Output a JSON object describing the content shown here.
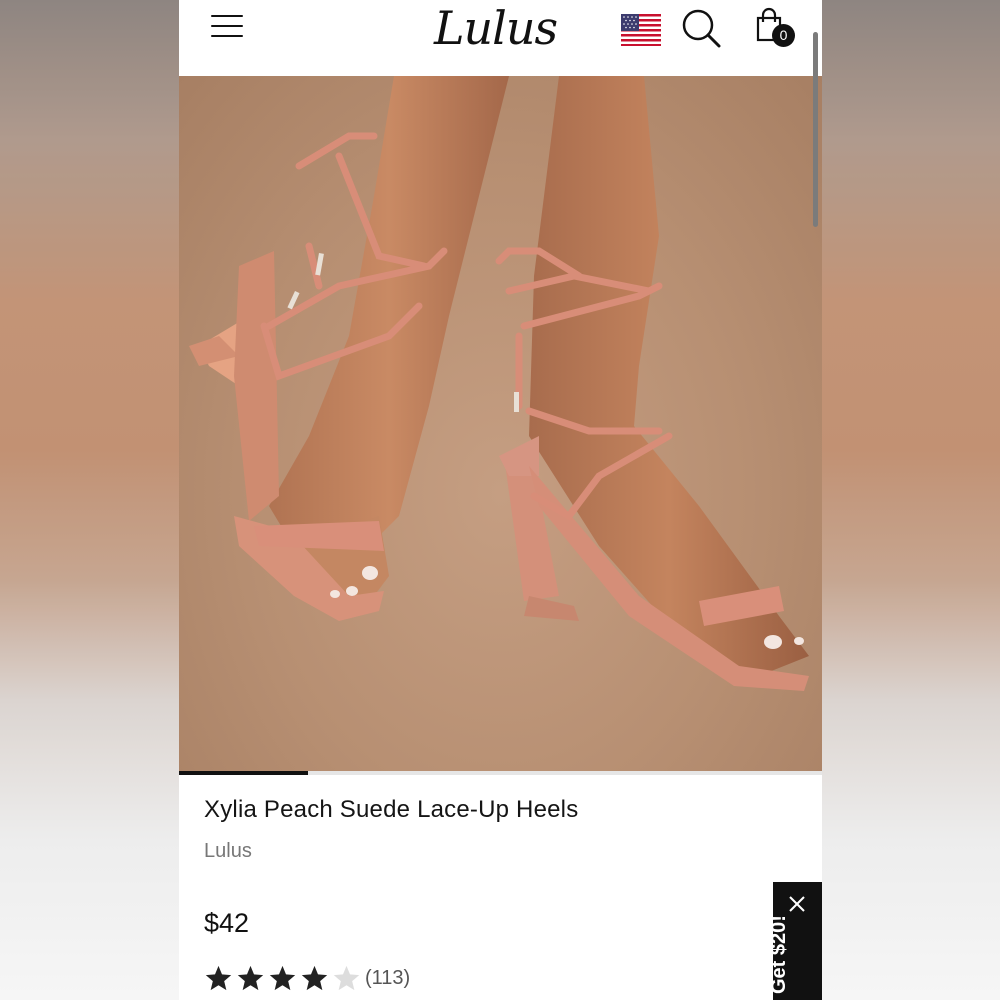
{
  "header": {
    "menu_icon": "hamburger-menu-icon",
    "logo_text": "Lulus",
    "flag_icon": "us-flag-icon",
    "search_icon": "search-icon",
    "bag_icon": "shopping-bag-icon",
    "bag_count": "0"
  },
  "carousel": {
    "progress": 0.2
  },
  "product": {
    "title": "Xylia Peach Suede Lace-Up Heels",
    "brand": "Lulus",
    "price": "$42",
    "rating": 4,
    "rating_max": 5,
    "review_count": "(113)"
  },
  "promo": {
    "text": "Get $20!",
    "close_icon": "close-icon"
  },
  "colors": {
    "text": "#111111",
    "muted": "#777777",
    "star_filled": "#222222",
    "star_empty": "#dddddd",
    "suede_peach": "#d68f79",
    "backdrop": "#b98f71"
  }
}
